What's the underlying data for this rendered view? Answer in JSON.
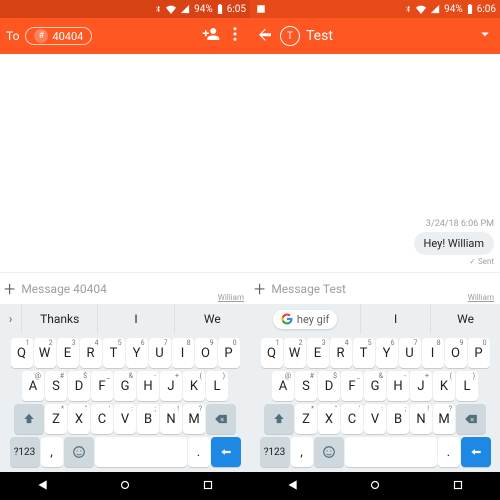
{
  "left": {
    "status": {
      "battery_pct": "94%",
      "time": "6:05"
    },
    "header": {
      "to_label": "To",
      "chip_symbol": "#",
      "chip_text": "40404"
    },
    "compose": {
      "placeholder": "Message 40404",
      "signature": "William"
    },
    "suggest": {
      "expand_glyph": "›",
      "items": [
        "Thanks",
        "I",
        "We"
      ]
    }
  },
  "right": {
    "status": {
      "battery_pct": "94%",
      "time": "6:06"
    },
    "header": {
      "avatar_initial": "T",
      "title": "Test"
    },
    "conversation": {
      "timestamp": "3/24/18 6:06 PM",
      "bubble_text": "Hey! William",
      "sent_label": "✓ Sent"
    },
    "compose": {
      "placeholder": "Message Test",
      "signature": "William"
    },
    "suggest": {
      "search_text": "hey gif",
      "items_tail": [
        "I",
        "We"
      ]
    }
  },
  "keyboard": {
    "row1": [
      {
        "k": "Q",
        "s": "1"
      },
      {
        "k": "W",
        "s": "2"
      },
      {
        "k": "E",
        "s": "3"
      },
      {
        "k": "R",
        "s": "4"
      },
      {
        "k": "T",
        "s": "5"
      },
      {
        "k": "Y",
        "s": "6"
      },
      {
        "k": "U",
        "s": "7"
      },
      {
        "k": "I",
        "s": "8"
      },
      {
        "k": "O",
        "s": "9"
      },
      {
        "k": "P",
        "s": "0"
      }
    ],
    "row2": [
      {
        "k": "A",
        "s": "@"
      },
      {
        "k": "S",
        "s": "#"
      },
      {
        "k": "D",
        "s": "$"
      },
      {
        "k": "F",
        "s": "_"
      },
      {
        "k": "G",
        "s": "&"
      },
      {
        "k": "H",
        "s": "-"
      },
      {
        "k": "J",
        "s": "+"
      },
      {
        "k": "K",
        "s": "("
      },
      {
        "k": "L",
        "s": ")"
      }
    ],
    "row3": [
      {
        "k": "Z",
        "s": "*"
      },
      {
        "k": "X",
        "s": "\""
      },
      {
        "k": "C",
        "s": "'"
      },
      {
        "k": "V",
        "s": ":"
      },
      {
        "k": "B",
        "s": ";"
      },
      {
        "k": "N",
        "s": "!"
      },
      {
        "k": "M",
        "s": "?"
      }
    ],
    "sym_label": "?123",
    "comma": ",",
    "period": "."
  }
}
